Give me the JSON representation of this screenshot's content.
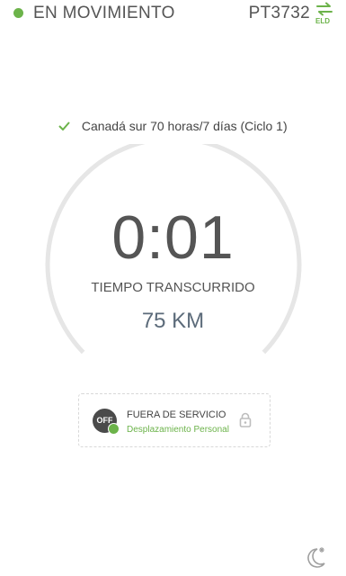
{
  "header": {
    "status": "EN MOVIMIENTO",
    "unit_id": "PT3732",
    "eld_label": "ELD",
    "status_color": "#6cb34a"
  },
  "cycle": {
    "label": "Canadá sur 70 horas/7 días (Ciclo 1)",
    "icon": "check-icon"
  },
  "timer": {
    "value": "0:01",
    "label": "TIEMPO TRANSCURRIDO"
  },
  "distance": {
    "value": "75 KM"
  },
  "duty": {
    "badge": "OFF",
    "title": "FUERA DE SERVICIO",
    "subtitle": "Desplazamiento Personal",
    "lock_icon": "lock-icon"
  },
  "footer": {
    "icon": "night-mode-icon"
  },
  "colors": {
    "accent": "#6cb34a",
    "gauge_track": "#e6e6e6",
    "distance": "#5c6b7a"
  }
}
